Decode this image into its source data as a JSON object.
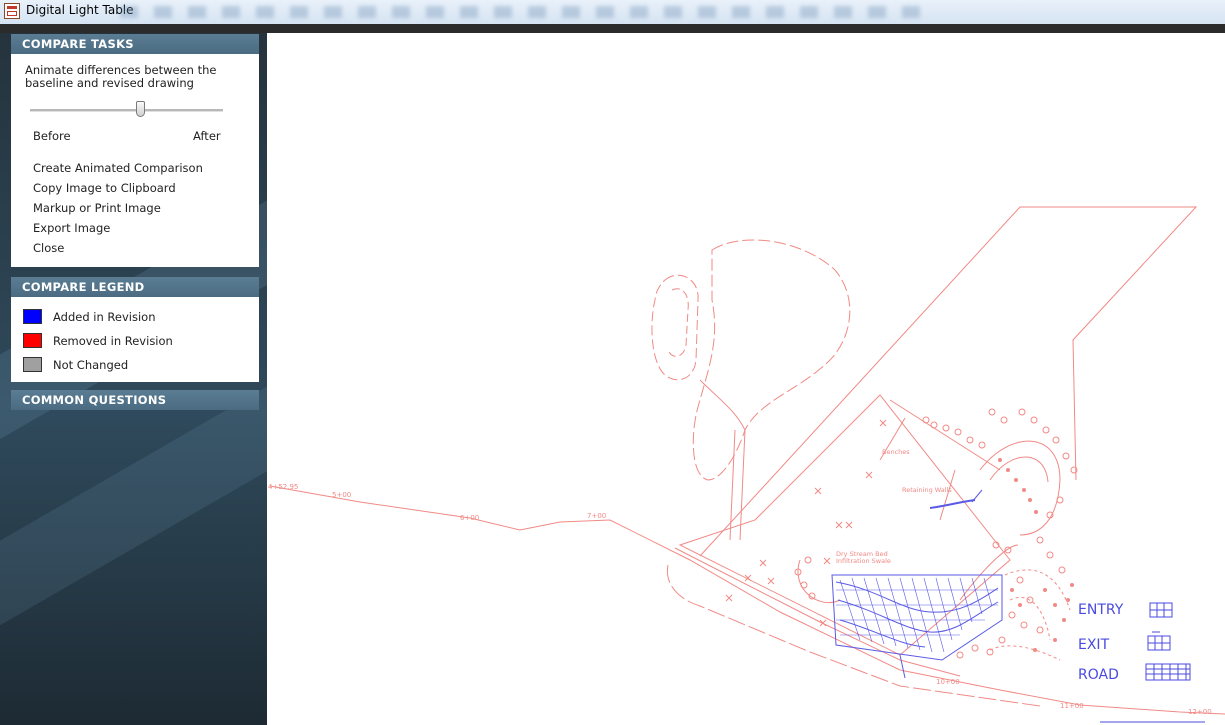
{
  "window": {
    "title": "Digital Light Table"
  },
  "compare_tasks": {
    "header": "COMPARE TASKS",
    "description": "Animate differences between the baseline and revised drawing",
    "slider": {
      "min_label": "Before",
      "max_label": "After",
      "position": 0.57
    },
    "actions": [
      "Create Animated Comparison",
      "Copy Image to Clipboard",
      "Markup or Print Image",
      "Export Image",
      "Close"
    ]
  },
  "compare_legend": {
    "header": "COMPARE LEGEND",
    "items": [
      {
        "label": "Added in Revision",
        "color": "#0000ff"
      },
      {
        "label": "Removed in Revision",
        "color": "#ff0000"
      },
      {
        "label": "Not Changed",
        "color": "#a0a0a0"
      }
    ]
  },
  "common_questions": {
    "header": "COMMON QUESTIONS"
  },
  "drawing": {
    "colors": {
      "removed": "#f08a86",
      "added": "#5a5ae6"
    },
    "annotations": [
      "Benches",
      "Retaining Walls",
      "Dry Stream Bed",
      "Infiltration Swale"
    ],
    "stations": [
      "4+52.95",
      "5+00",
      "6+00",
      "7+00",
      "10+00",
      "11+00",
      "12+00"
    ],
    "legend_labels": [
      "ENTRY",
      "EXIT",
      "ROAD"
    ]
  }
}
